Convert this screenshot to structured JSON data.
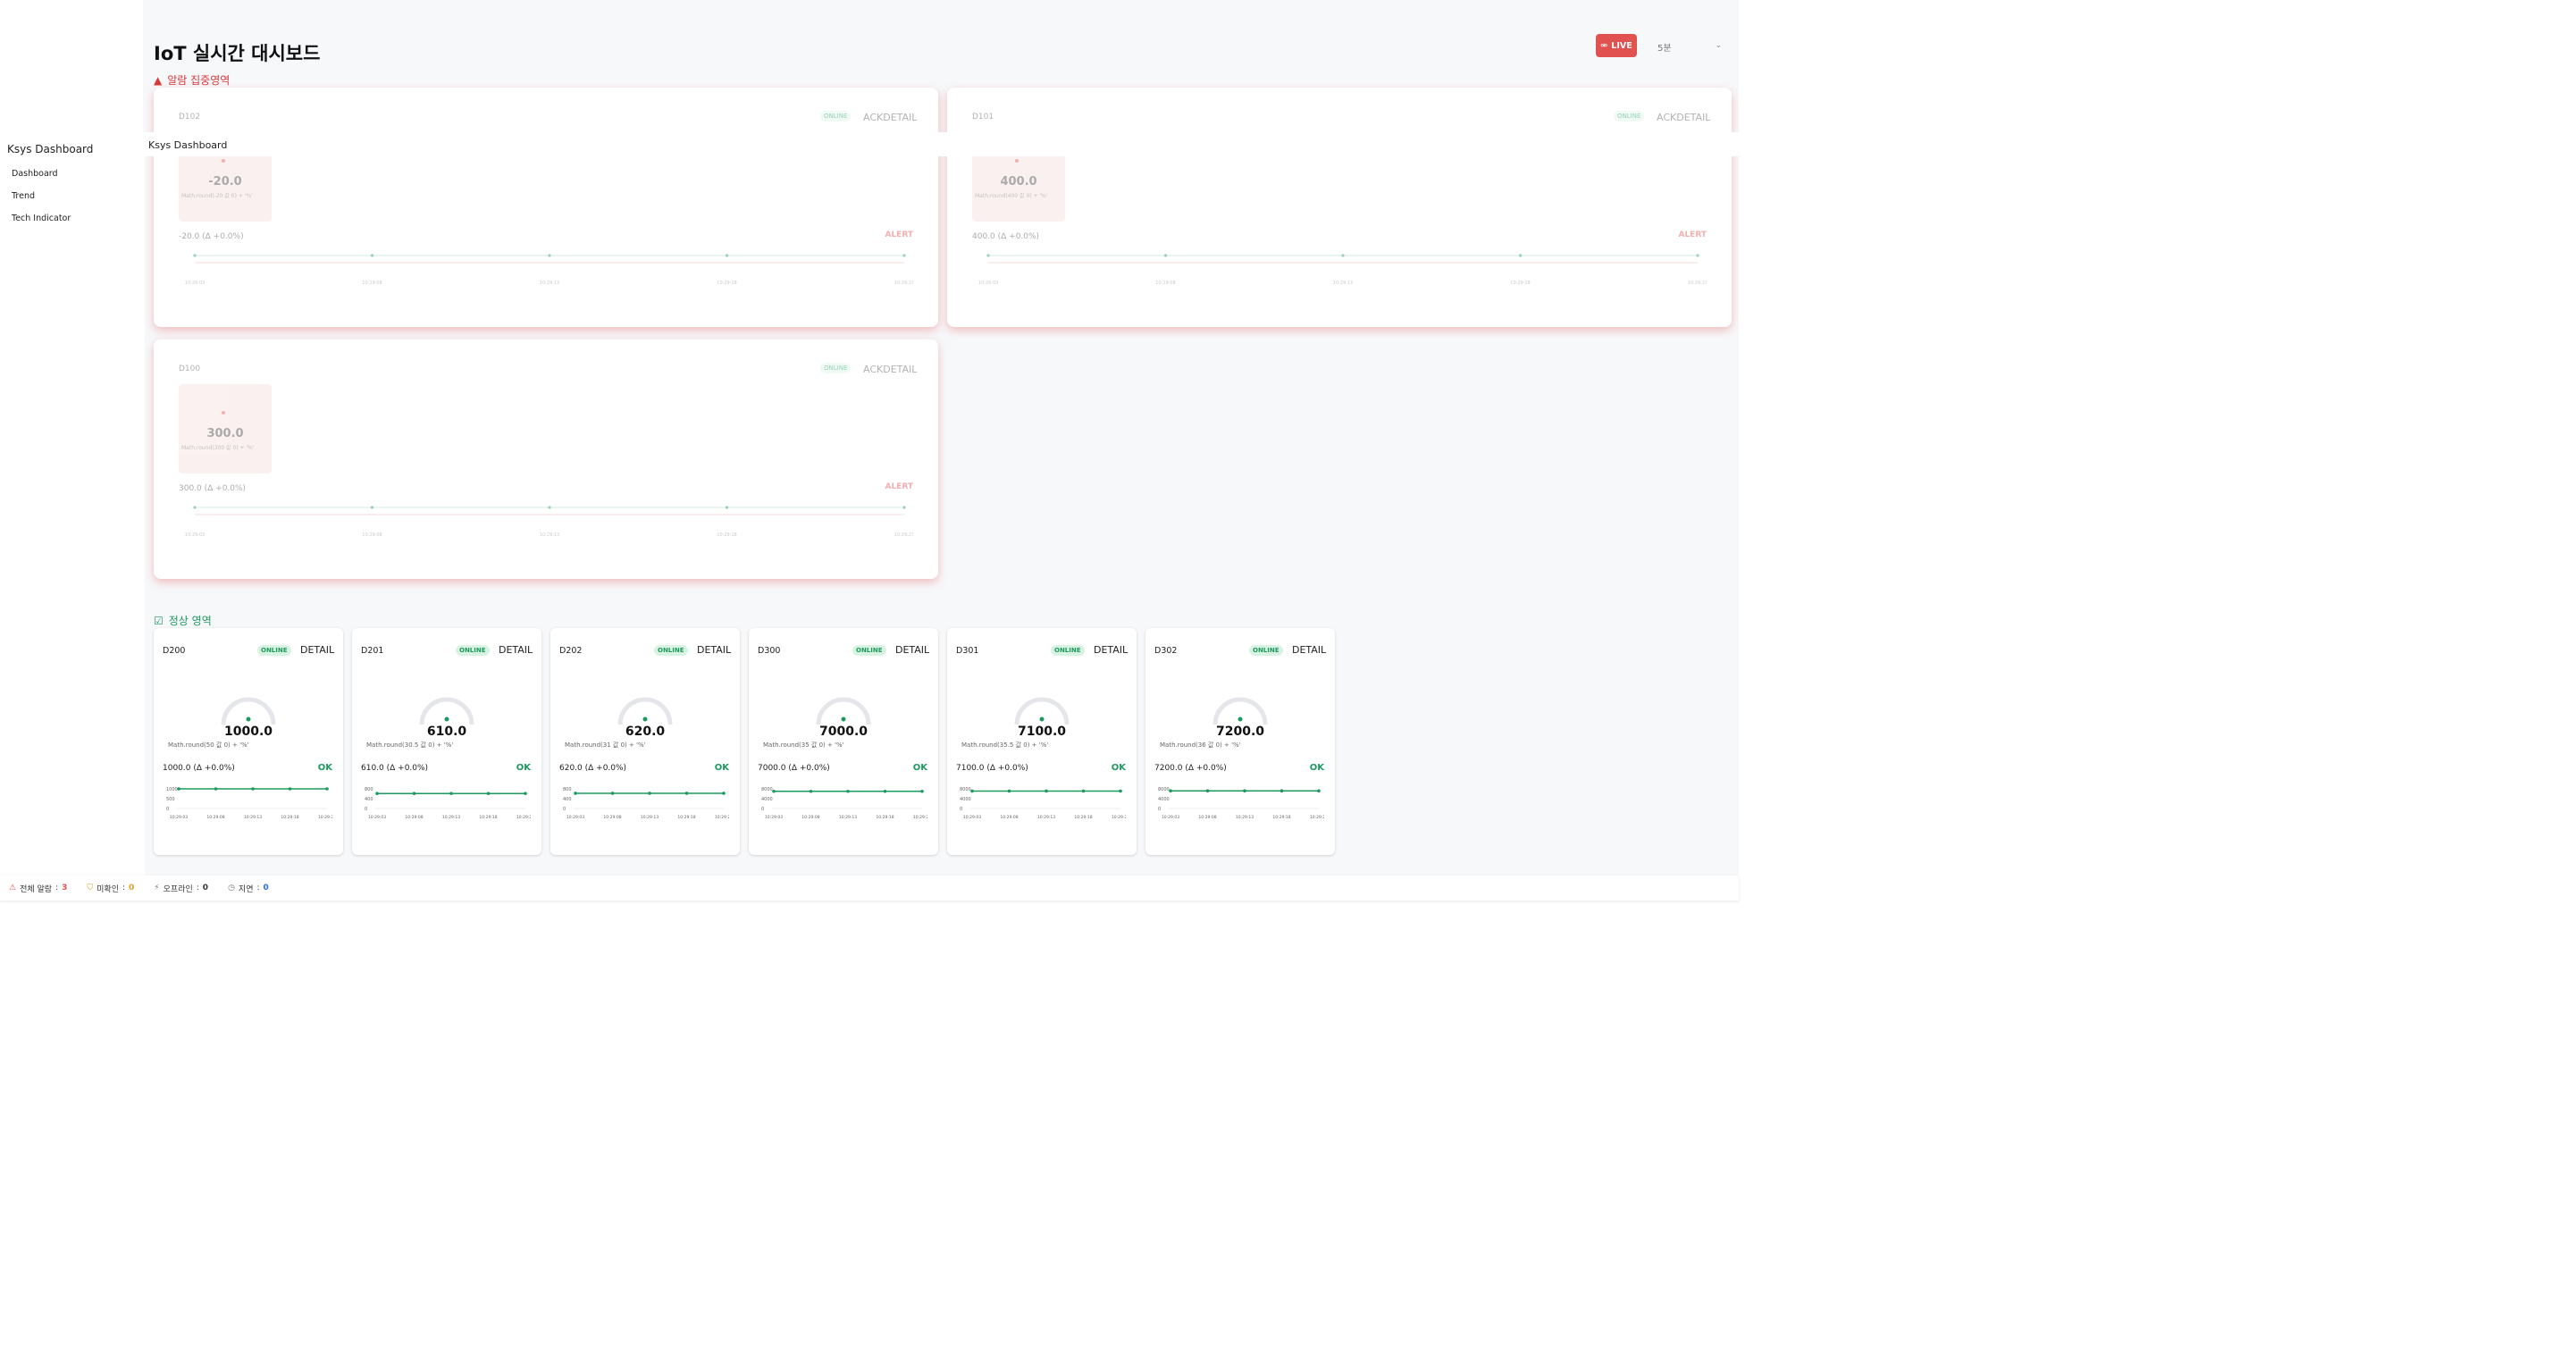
{
  "app": {
    "brand": "Ksys Dashboard",
    "topbar_title": "Ksys Dashboard",
    "page_title": "IoT 실시간 대시보드"
  },
  "sidebar": {
    "items": [
      {
        "label": "Dashboard"
      },
      {
        "label": "Trend"
      },
      {
        "label": "Tech Indicator"
      }
    ]
  },
  "header": {
    "live_label": "LIVE",
    "interval_selected": "5분"
  },
  "sections": {
    "alarm_title": "알람 집중영역",
    "normal_title": "정상 영역"
  },
  "alarm_cards": [
    {
      "device": "D102",
      "status": "ONLINE",
      "ack": "ACK",
      "detail": "DETAIL",
      "value": "-20.0",
      "formula": "Math.round(-20 값 0) + '%'",
      "delta": "-20.0 (Δ +0.0%)",
      "state": "ALERT",
      "trend": [
        -20,
        -20,
        -20,
        -20,
        -20
      ],
      "times": [
        "10:29:03",
        "10:29:08",
        "10:29:13",
        "10:29:18",
        "10:29:23"
      ]
    },
    {
      "device": "D101",
      "status": "ONLINE",
      "ack": "ACK",
      "detail": "DETAIL",
      "value": "400.0",
      "formula": "Math.round(400 값 0) + '%'",
      "delta": "400.0 (Δ +0.0%)",
      "state": "ALERT",
      "trend": [
        400,
        400,
        400,
        400,
        400
      ],
      "times": [
        "10:29:03",
        "10:29:08",
        "10:29:13",
        "10:29:18",
        "10:29:23"
      ]
    },
    {
      "device": "D100",
      "status": "ONLINE",
      "ack": "ACK",
      "detail": "DETAIL",
      "value": "300.0",
      "formula": "Math.round(300 값 0) + '%'",
      "delta": "300.0 (Δ +0.0%)",
      "state": "ALERT",
      "trend": [
        300,
        300,
        300,
        300,
        300
      ],
      "times": [
        "10:29:03",
        "10:29:08",
        "10:29:13",
        "10:29:18",
        "10:29:23"
      ]
    }
  ],
  "normal_cards": [
    {
      "device": "D200",
      "status": "ONLINE",
      "detail": "DETAIL",
      "value": "1000.0",
      "formula": "Math.round(50 값 0) + '%'",
      "delta": "1000.0 (Δ +0.0%)",
      "state": "OK",
      "ticks": [
        "1000",
        "500",
        "0"
      ],
      "trend": [
        1000,
        1000,
        1000,
        1000,
        1000
      ],
      "times": [
        "10:29:03",
        "10:29:08",
        "10:29:13",
        "10:29:18",
        "10:29:23"
      ]
    },
    {
      "device": "D201",
      "status": "ONLINE",
      "detail": "DETAIL",
      "value": "610.0",
      "formula": "Math.round(30.5 값 0) + '%'",
      "delta": "610.0 (Δ +0.0%)",
      "state": "OK",
      "ticks": [
        "800",
        "400",
        "0"
      ],
      "trend": [
        610,
        610,
        610,
        610,
        610
      ],
      "times": [
        "10:29:03",
        "10:29:08",
        "10:29:13",
        "10:29:18",
        "10:29:23"
      ]
    },
    {
      "device": "D202",
      "status": "ONLINE",
      "detail": "DETAIL",
      "value": "620.0",
      "formula": "Math.round(31 값 0) + '%'",
      "delta": "620.0 (Δ +0.0%)",
      "state": "OK",
      "ticks": [
        "800",
        "400",
        "0"
      ],
      "trend": [
        620,
        620,
        620,
        620,
        620
      ],
      "times": [
        "10:29:03",
        "10:29:08",
        "10:29:13",
        "10:29:18",
        "10:29:23"
      ]
    },
    {
      "device": "D300",
      "status": "ONLINE",
      "detail": "DETAIL",
      "value": "7000.0",
      "formula": "Math.round(35 값 0) + '%'",
      "delta": "7000.0 (Δ +0.0%)",
      "state": "OK",
      "ticks": [
        "8000",
        "4000",
        "0"
      ],
      "trend": [
        7000,
        7000,
        7000,
        7000,
        7000
      ],
      "times": [
        "10:29:03",
        "10:29:08",
        "10:29:13",
        "10:29:18",
        "10:29:23"
      ]
    },
    {
      "device": "D301",
      "status": "ONLINE",
      "detail": "DETAIL",
      "value": "7100.0",
      "formula": "Math.round(35.5 값 0) + '%'",
      "delta": "7100.0 (Δ +0.0%)",
      "state": "OK",
      "ticks": [
        "8000",
        "4000",
        "0"
      ],
      "trend": [
        7100,
        7100,
        7100,
        7100,
        7100
      ],
      "times": [
        "10:29:03",
        "10:29:08",
        "10:29:13",
        "10:29:18",
        "10:29:23"
      ]
    },
    {
      "device": "D302",
      "status": "ONLINE",
      "detail": "DETAIL",
      "value": "7200.0",
      "formula": "Math.round(36 값 0) + '%'",
      "delta": "7200.0 (Δ +0.0%)",
      "state": "OK",
      "ticks": [
        "8000",
        "4000",
        "0"
      ],
      "trend": [
        7200,
        7200,
        7200,
        7200,
        7200
      ],
      "times": [
        "10:29:03",
        "10:29:08",
        "10:29:13",
        "10:29:18",
        "10:29:23"
      ]
    }
  ],
  "statusbar": {
    "total_alarm_label": "전체 알람",
    "total_alarm": "3",
    "unack_label": "미확인",
    "unack": "0",
    "offline_label": "오프라인",
    "offline": "0",
    "delay_label": "지연",
    "delay": "0"
  },
  "colors": {
    "alert": "#e0514f",
    "ok": "#1d9a5f",
    "bg": "#f7f8fa"
  }
}
